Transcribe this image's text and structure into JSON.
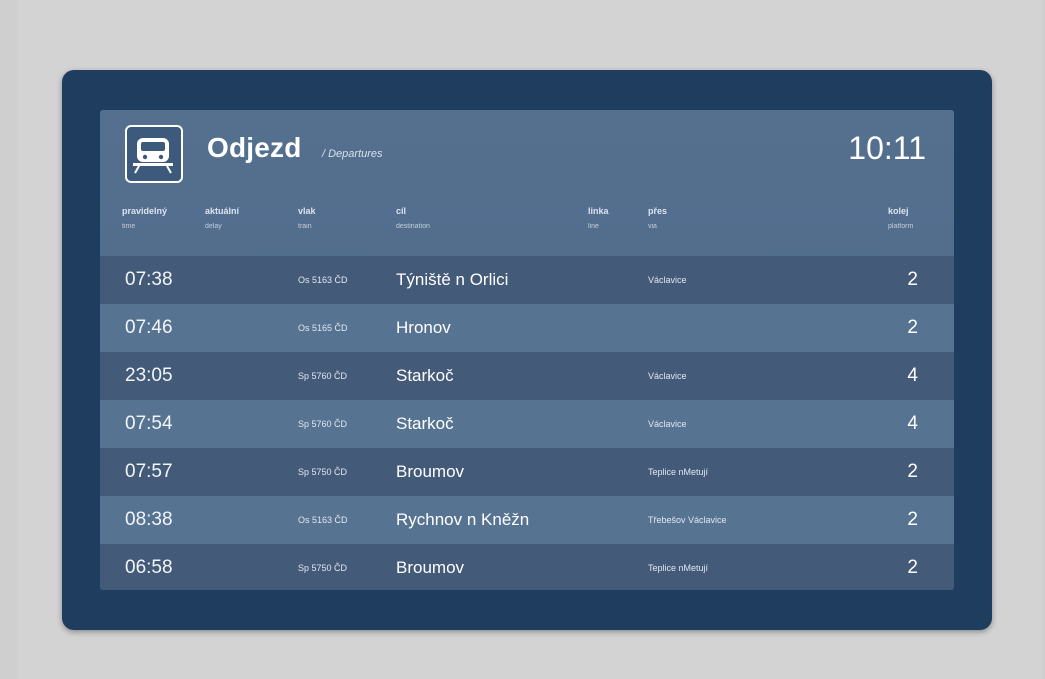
{
  "board": {
    "title": "Odjezd",
    "subtitle": "/ Departures",
    "clock": "10:11"
  },
  "columns": [
    {
      "cs": "pravidelný",
      "en": "time"
    },
    {
      "cs": "aktuální",
      "en": "delay"
    },
    {
      "cs": "vlak",
      "en": "train"
    },
    {
      "cs": "cíl",
      "en": "destination"
    },
    {
      "cs": "linka",
      "en": "line"
    },
    {
      "cs": "přes",
      "en": "via"
    },
    {
      "cs": "kolej",
      "en": "platform"
    }
  ],
  "rows": [
    {
      "time": "07:38",
      "train": "Os 5163 ČD",
      "dest": "Týniště n Orlici",
      "via": "Václavice",
      "track": "2"
    },
    {
      "time": "07:46",
      "train": "Os 5165 ČD",
      "dest": "Hronov",
      "via": "",
      "track": "2"
    },
    {
      "time": "23:05",
      "train": "Sp 5760 ČD",
      "dest": "Starkoč",
      "via": "Václavice",
      "track": "4"
    },
    {
      "time": "07:54",
      "train": "Sp 5760 ČD",
      "dest": "Starkoč",
      "via": "Václavice",
      "track": "4"
    },
    {
      "time": "07:57",
      "train": "Sp 5750 ČD",
      "dest": "Broumov",
      "via": "Teplice nMetují",
      "track": "2"
    },
    {
      "time": "08:38",
      "train": "Os 5163 ČD",
      "dest": "Rychnov n Kněžn",
      "via": "Třebešov Václavice",
      "track": "2"
    },
    {
      "time": "06:58",
      "train": "Sp 5750 ČD",
      "dest": "Broumov",
      "via": "Teplice nMetují",
      "track": "2"
    }
  ]
}
